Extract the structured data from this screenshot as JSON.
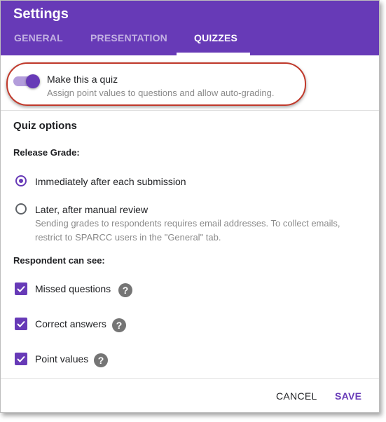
{
  "dialog": {
    "title": "Settings"
  },
  "tabs": [
    {
      "label": "GENERAL"
    },
    {
      "label": "PRESENTATION"
    },
    {
      "label": "QUIZZES"
    }
  ],
  "quiz_toggle": {
    "label": "Make this a quiz",
    "description": "Assign point values to questions and allow auto-grading.",
    "on": true
  },
  "quiz_options": {
    "title": "Quiz options",
    "release_grade": {
      "heading": "Release Grade:",
      "options": [
        {
          "label": "Immediately after each submission",
          "selected": true
        },
        {
          "label": "Later, after manual review",
          "selected": false,
          "help_line1": "Sending grades to respondents requires email addresses. To collect emails,",
          "help_line2": "restrict to SPARCC users in the \"General\" tab."
        }
      ]
    },
    "respondent_can_see": {
      "heading": "Respondent can see:",
      "items": [
        {
          "label": "Missed questions",
          "checked": true
        },
        {
          "label": "Correct answers",
          "checked": true
        },
        {
          "label": "Point values",
          "checked": true
        }
      ]
    }
  },
  "help_icon_glyph": "?",
  "footer": {
    "cancel_label": "CANCEL",
    "save_label": "SAVE"
  },
  "colors": {
    "accent": "#673ab7",
    "highlight_border": "#c0392b"
  }
}
